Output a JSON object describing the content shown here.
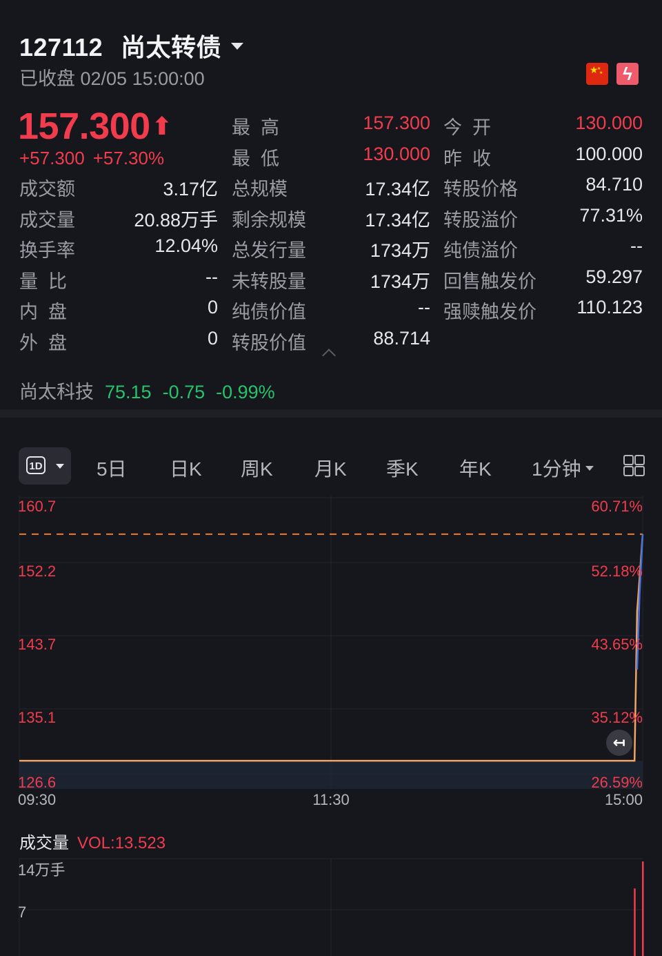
{
  "header": {
    "code": "127112",
    "name": "尚太转债",
    "status": "已收盘 02/05 15:00:00"
  },
  "quote": {
    "price": "157.300",
    "change": "+57.300",
    "change_pct": "+57.30%"
  },
  "stats": {
    "col1": [
      {
        "label": "成交额",
        "value": "3.17亿"
      },
      {
        "label": "成交量",
        "value": "20.88万手"
      },
      {
        "label": "换手率",
        "value": "12.04%"
      },
      {
        "label": "量  比",
        "value": "--"
      },
      {
        "label": "内  盘",
        "value": "0"
      },
      {
        "label": "外  盘",
        "value": "0"
      }
    ],
    "col2": [
      {
        "label": "最  高",
        "value": "157.300",
        "color": "#f03c4d"
      },
      {
        "label": "最  低",
        "value": "130.000",
        "color": "#f03c4d"
      },
      {
        "label": "总规模",
        "value": "17.34亿"
      },
      {
        "label": "剩余规模",
        "value": "17.34亿"
      },
      {
        "label": "总发行量",
        "value": "1734万"
      },
      {
        "label": "未转股量",
        "value": "1734万"
      },
      {
        "label": "纯债价值",
        "value": "--"
      },
      {
        "label": "转股价值",
        "value": "88.714"
      }
    ],
    "col3": [
      {
        "label": "今  开",
        "value": "130.000",
        "color": "#f03c4d"
      },
      {
        "label": "昨  收",
        "value": "100.000"
      },
      {
        "label": "转股价格",
        "value": "84.710"
      },
      {
        "label": "转股溢价",
        "value": "77.31%"
      },
      {
        "label": "纯债溢价",
        "value": "--"
      },
      {
        "label": "回售触发价",
        "value": "59.297"
      },
      {
        "label": "强赎触发价",
        "value": "110.123"
      }
    ]
  },
  "underlying": {
    "name": "尚太科技",
    "price": "75.15",
    "change": "-0.75",
    "change_pct": "-0.99%"
  },
  "tabs": {
    "active": "1D",
    "items": [
      "5日",
      "日K",
      "周K",
      "月K",
      "季K",
      "年K"
    ],
    "interval": "1分钟"
  },
  "chart_data": [
    {
      "type": "line",
      "title": "",
      "x_labels": [
        "09:30",
        "11:30",
        "15:00"
      ],
      "y_ticks_left": [
        "160.7",
        "152.2",
        "143.7",
        "135.1",
        "126.6"
      ],
      "y_ticks_right": [
        "60.71%",
        "52.18%",
        "43.65%",
        "35.12%",
        "26.59%"
      ],
      "ylim": [
        126.6,
        160.7
      ],
      "reference_line": {
        "value": 157.3,
        "style": "dashed",
        "color": "#f07a2a"
      },
      "series": [
        {
          "color": "#f0a566",
          "points": [
            [
              0,
              130.0
            ],
            [
              0.987,
              130.0
            ],
            [
              0.991,
              148.0
            ],
            [
              0.995,
              152.0
            ],
            [
              1.0,
              157.3
            ]
          ]
        },
        {
          "color": "#3f6fe0",
          "points": [
            [
              0.991,
              141.0
            ],
            [
              0.995,
              150.0
            ],
            [
              1.0,
              157.3
            ]
          ]
        }
      ],
      "grid": true
    },
    {
      "type": "bar",
      "title": "成交量",
      "indicator": "VOL:13.523",
      "y_ticks": [
        "14万手",
        "7"
      ],
      "ylim": [
        0,
        14
      ],
      "bars": [
        {
          "x": 0.987,
          "value": 10
        },
        {
          "x": 1.0,
          "value": 14
        }
      ]
    }
  ],
  "colors": {
    "up": "#f03c4d",
    "down": "#27c26c",
    "background": "#16171c"
  }
}
